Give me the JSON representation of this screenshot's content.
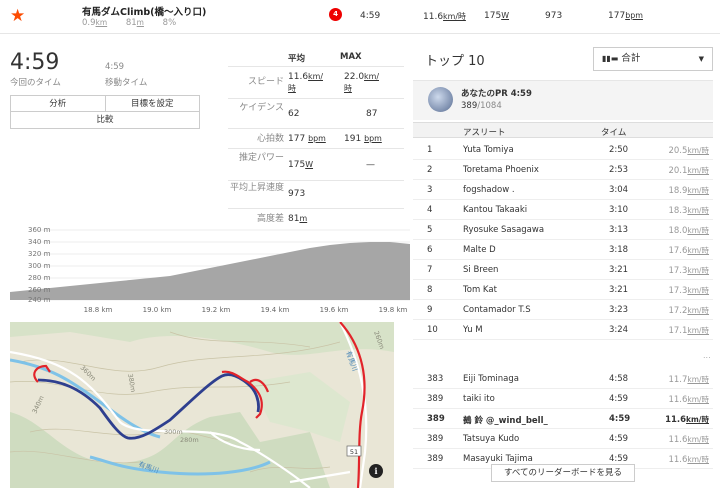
{
  "segment": {
    "name": "有馬ダムClimb(橋〜入り口)",
    "distance": "0.9",
    "distance_unit": "km",
    "elev_gain": "81",
    "elev_unit": "m",
    "grade": "8%",
    "rank_badge": "4",
    "time": "4:59",
    "speed": "11.6",
    "speed_unit": "km/時",
    "power": "175",
    "power_unit": "W",
    "vam": "973",
    "hr": "177",
    "hr_unit": "bpm"
  },
  "summary": {
    "elapsed_time": "4:59",
    "elapsed_label": "今回のタイム",
    "moving_time": "4:59",
    "moving_label": "移動タイム"
  },
  "buttons": {
    "analysis": "分析",
    "goal": "目標を設定",
    "compare": "比較"
  },
  "stats": {
    "head_avg": "平均",
    "head_max": "MAX",
    "speed_label": "スピード",
    "speed_avg": "11.6",
    "speed_avg_unit": "km/時",
    "speed_max": "22.0",
    "speed_max_unit": "km/時",
    "cadence_label": "ケイデンス",
    "cadence_avg": "62",
    "cadence_max": "87",
    "hr_label": "心拍数",
    "hr_avg": "177",
    "hr_max": "191",
    "hr_unit": "bpm",
    "power_label": "推定パワー",
    "power_avg": "175",
    "power_unit": "W",
    "power_max": "—",
    "climb_label": "平均上昇速度",
    "climb_val": "973",
    "elev_label": "高度差",
    "elev_val": "81",
    "elev_unit": "m"
  },
  "elevation": {
    "y_ticks": [
      "360 m",
      "340 m",
      "320 m",
      "300 m",
      "280 m",
      "260 m",
      "240 m"
    ],
    "x_ticks": [
      "18.8 km",
      "19.0 km",
      "19.2 km",
      "19.4 km",
      "19.6 km",
      "19.8 km"
    ]
  },
  "map": {
    "labels": [
      "360m",
      "380m",
      "340m",
      "300m",
      "280m",
      "260m",
      "有馬川",
      "有馬川",
      "51"
    ],
    "info_icon": "i"
  },
  "leaderboard": {
    "title": "トップ 10",
    "filter": "合計",
    "pr_title": "あなたのPR 4:59",
    "pr_rank": "389",
    "pr_total": "/1084",
    "col_athlete": "アスリート",
    "col_time": "タイム",
    "rows": [
      {
        "rank": "1",
        "name": "Yuta Tomiya",
        "time": "2:50",
        "speed": "20.5",
        "unit": "km/時"
      },
      {
        "rank": "2",
        "name": "Toretama Phoenix",
        "time": "2:53",
        "speed": "20.1",
        "unit": "km/時"
      },
      {
        "rank": "3",
        "name": "fogshadow .",
        "time": "3:04",
        "speed": "18.9",
        "unit": "km/時"
      },
      {
        "rank": "4",
        "name": "Kantou Takaaki",
        "time": "3:10",
        "speed": "18.3",
        "unit": "km/時"
      },
      {
        "rank": "5",
        "name": "Ryosuke Sasagawa",
        "time": "3:13",
        "speed": "18.0",
        "unit": "km/時"
      },
      {
        "rank": "6",
        "name": "Malte D",
        "time": "3:18",
        "speed": "17.6",
        "unit": "km/時"
      },
      {
        "rank": "7",
        "name": "Si Breen",
        "time": "3:21",
        "speed": "17.3",
        "unit": "km/時"
      },
      {
        "rank": "8",
        "name": "Tom Kat",
        "time": "3:21",
        "speed": "17.3",
        "unit": "km/時"
      },
      {
        "rank": "9",
        "name": "Contamador T.S",
        "time": "3:23",
        "speed": "17.2",
        "unit": "km/時"
      },
      {
        "rank": "10",
        "name": "Yu M",
        "time": "3:24",
        "speed": "17.1",
        "unit": "km/時"
      },
      {
        "rank": "383",
        "name": "Eiji Tominaga",
        "time": "4:58",
        "speed": "11.7",
        "unit": "km/時"
      },
      {
        "rank": "389",
        "name": "taiki ito",
        "time": "4:59",
        "speed": "11.6",
        "unit": "km/時"
      },
      {
        "rank": "389",
        "name": "鵺 鈴 @_wind_bell_",
        "time": "4:59",
        "speed": "11.6",
        "unit": "km/時",
        "me": true
      },
      {
        "rank": "389",
        "name": "Tatsuya Kudo",
        "time": "4:59",
        "speed": "11.6",
        "unit": "km/時"
      },
      {
        "rank": "389",
        "name": "Masayuki Tajima",
        "time": "4:59",
        "speed": "11.6",
        "unit": "km/時"
      }
    ],
    "ellipsis": "...",
    "see_all": "すべてのリーダーボードを見る"
  }
}
